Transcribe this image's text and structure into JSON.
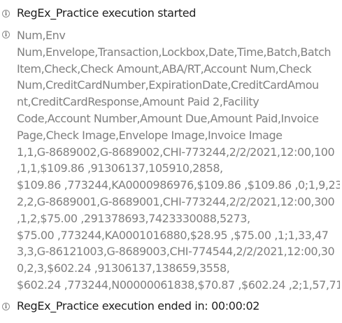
{
  "log": {
    "start_message": "RegEx_Practice execution started",
    "output_lines": [
      "Num,Env",
      "Num,Envelope,Transaction,Lockbox,Date,Time,Batch,Batch",
      "Item,Check,Check Amount,ABA/RT,Account Num,Check",
      "Num,CreditCardNumber,ExpirationDate,CreditCardAmou",
      "nt,CreditCardResponse,Amount Paid 2,Facility",
      "Code,Account Number,Amount Due,Amount Paid,Invoice",
      "Page,Check Image,Envelope Image,Invoice Image",
      "1,1,G-8689002,G-8689002,CHI-773244,2/2/2021,12:00,100",
      ",1,1,$109.86 ,91306137,105910,2858,",
      "$109.86 ,773244,KA0000986976,$109.86 ,$109.86 ,0;1,9,23",
      "2,2,G-8689001,G-8689001,CHI-773244,2/2/2021,12:00,300",
      ",1,2,$75.00 ,291378693,7423330088,5273,",
      "$75.00 ,773244,KA0001016880,$28.95 ,$75.00 ,1;1,33,47",
      "3,3,G-86121003,G-8689003,CHI-774544,2/2/2021,12:00,30",
      "0,2,3,$602.24 ,91306137,138659,3558,",
      "$602.24 ,773244,N00000061838,$70.87 ,$602.24 ,2;1,57,71"
    ],
    "end_message": "RegEx_Practice execution ended in: 00:00:02",
    "info_icon_glyph": "i",
    "colors": {
      "message_text": "#1f1f1f",
      "output_text": "#7f7f7f",
      "icon": "#8a8a8a"
    }
  }
}
